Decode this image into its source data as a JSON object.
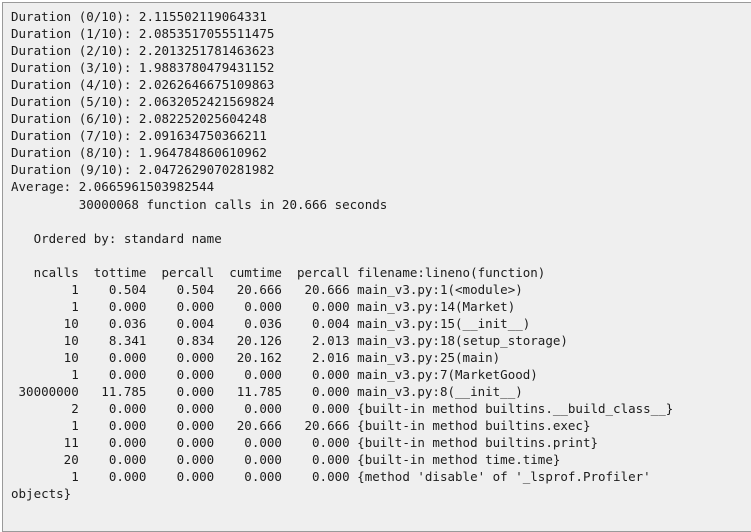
{
  "window": {
    "kind": "terminal-console-output",
    "background_color": "#efefef",
    "border_color": "#9a9a9a",
    "text_color": "#1c1c1c"
  },
  "console": {
    "name": "python-cprofile-output",
    "lines": [
      "Duration (0/10): 2.115502119064331",
      "Duration (1/10): 2.0853517055511475",
      "Duration (2/10): 2.2013251781463623",
      "Duration (3/10): 1.9883780479431152",
      "Duration (4/10): 2.0262646675109863",
      "Duration (5/10): 2.0632052421569824",
      "Duration (6/10): 2.082252025604248",
      "Duration (7/10): 2.091634750366211",
      "Duration (8/10): 1.964784860610962",
      "Duration (9/10): 2.0472629070281982",
      "Average: 2.0665961503982544",
      "         30000068 function calls in 20.666 seconds",
      "",
      "   Ordered by: standard name",
      "",
      "   ncalls  tottime  percall  cumtime  percall filename:lineno(function)",
      "        1    0.504    0.504   20.666   20.666 main_v3.py:1(<module>)",
      "        1    0.000    0.000    0.000    0.000 main_v3.py:14(Market)",
      "       10    0.036    0.004    0.036    0.004 main_v3.py:15(__init__)",
      "       10    8.341    0.834   20.126    2.013 main_v3.py:18(setup_storage)",
      "       10    0.000    0.000   20.162    2.016 main_v3.py:25(main)",
      "        1    0.000    0.000    0.000    0.000 main_v3.py:7(MarketGood)",
      " 30000000   11.785    0.000   11.785    0.000 main_v3.py:8(__init__)",
      "        2    0.000    0.000    0.000    0.000 {built-in method builtins.__build_class__}",
      "        1    0.000    0.000   20.666   20.666 {built-in method builtins.exec}",
      "       11    0.000    0.000    0.000    0.000 {built-in method builtins.print}",
      "       20    0.000    0.000    0.000    0.000 {built-in method time.time}",
      "        1    0.000    0.000    0.000    0.000 {method 'disable' of '_lsprof.Profiler'",
      "objects}"
    ],
    "durations": {
      "label_prefix": "Duration",
      "total_runs": 10,
      "values": [
        "2.115502119064331",
        "2.0853517055511475",
        "2.2013251781463623",
        "1.9883780479431152",
        "2.0262646675109863",
        "2.0632052421569824",
        "2.082252025604248",
        "2.091634750366211",
        "1.964784860610962",
        "2.0472629070281982"
      ],
      "average_label": "Average:",
      "average_value": "2.0665961503982544"
    },
    "profile_summary": {
      "function_calls": "30000068",
      "seconds": "20.666",
      "summary_text": "30000068 function calls in 20.666 seconds",
      "ordered_by_label": "Ordered by:",
      "ordered_by_value": "standard name"
    },
    "profile_table": {
      "headers": [
        "ncalls",
        "tottime",
        "percall",
        "cumtime",
        "percall",
        "filename:lineno(function)"
      ],
      "rows": [
        [
          "1",
          "0.504",
          "0.504",
          "20.666",
          "20.666",
          "main_v3.py:1(<module>)"
        ],
        [
          "1",
          "0.000",
          "0.000",
          "0.000",
          "0.000",
          "main_v3.py:14(Market)"
        ],
        [
          "10",
          "0.036",
          "0.004",
          "0.036",
          "0.004",
          "main_v3.py:15(__init__)"
        ],
        [
          "10",
          "8.341",
          "0.834",
          "20.126",
          "2.013",
          "main_v3.py:18(setup_storage)"
        ],
        [
          "10",
          "0.000",
          "0.000",
          "20.162",
          "2.016",
          "main_v3.py:25(main)"
        ],
        [
          "1",
          "0.000",
          "0.000",
          "0.000",
          "0.000",
          "main_v3.py:7(MarketGood)"
        ],
        [
          "30000000",
          "11.785",
          "0.000",
          "11.785",
          "0.000",
          "main_v3.py:8(__init__)"
        ],
        [
          "2",
          "0.000",
          "0.000",
          "0.000",
          "0.000",
          "{built-in method builtins.__build_class__}"
        ],
        [
          "1",
          "0.000",
          "0.000",
          "20.666",
          "20.666",
          "{built-in method builtins.exec}"
        ],
        [
          "11",
          "0.000",
          "0.000",
          "0.000",
          "0.000",
          "{built-in method builtins.print}"
        ],
        [
          "20",
          "0.000",
          "0.000",
          "0.000",
          "0.000",
          "{built-in method time.time}"
        ],
        [
          "1",
          "0.000",
          "0.000",
          "0.000",
          "0.000",
          "{method 'disable' of '_lsprof.Profiler' objects}"
        ]
      ]
    }
  }
}
